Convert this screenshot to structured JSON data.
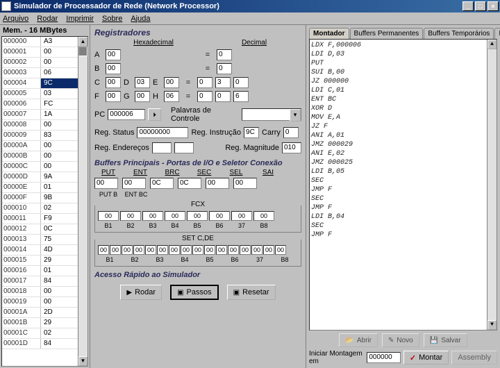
{
  "window": {
    "title": "Simulador de Processador de Rede (Network Processor)"
  },
  "menu": {
    "arquivo": "Arquivo",
    "rodar": "Rodar",
    "imprimir": "Imprimir",
    "sobre": "Sobre",
    "ajuda": "Ajuda"
  },
  "memory": {
    "title": "Mem. - 16 MBytes",
    "rows": [
      {
        "addr": "000000",
        "val": "A3"
      },
      {
        "addr": "000001",
        "val": "00"
      },
      {
        "addr": "000002",
        "val": "00"
      },
      {
        "addr": "000003",
        "val": "06"
      },
      {
        "addr": "000004",
        "val": "9C",
        "sel": true
      },
      {
        "addr": "000005",
        "val": "03"
      },
      {
        "addr": "000006",
        "val": "FC"
      },
      {
        "addr": "000007",
        "val": "1A"
      },
      {
        "addr": "000008",
        "val": "00"
      },
      {
        "addr": "000009",
        "val": "83"
      },
      {
        "addr": "00000A",
        "val": "00"
      },
      {
        "addr": "00000B",
        "val": "00"
      },
      {
        "addr": "00000C",
        "val": "00"
      },
      {
        "addr": "00000D",
        "val": "9A"
      },
      {
        "addr": "00000E",
        "val": "01"
      },
      {
        "addr": "00000F",
        "val": "9B"
      },
      {
        "addr": "000010",
        "val": "02"
      },
      {
        "addr": "000011",
        "val": "F9"
      },
      {
        "addr": "000012",
        "val": "0C"
      },
      {
        "addr": "000013",
        "val": "75"
      },
      {
        "addr": "000014",
        "val": "4D"
      },
      {
        "addr": "000015",
        "val": "29"
      },
      {
        "addr": "000016",
        "val": "01"
      },
      {
        "addr": "000017",
        "val": "84"
      },
      {
        "addr": "000018",
        "val": "00"
      },
      {
        "addr": "000019",
        "val": "00"
      },
      {
        "addr": "00001A",
        "val": "2D"
      },
      {
        "addr": "00001B",
        "val": "29"
      },
      {
        "addr": "00001C",
        "val": "02"
      },
      {
        "addr": "00001D",
        "val": "84"
      }
    ]
  },
  "registers": {
    "title": "Registradores",
    "hex_label": "Hexadecimal",
    "dec_label": "Decimal",
    "A": {
      "hex": "00",
      "dec": "0"
    },
    "B": {
      "hex": "00",
      "dec": "0"
    },
    "C": {
      "hex": "00",
      "dec": "0"
    },
    "D": {
      "hex": "03",
      "dec": "3"
    },
    "E": {
      "hex": "00",
      "dec": "0"
    },
    "F": {
      "hex": "00",
      "dec": "0"
    },
    "G": {
      "hex": "00",
      "dec": "0"
    },
    "H": {
      "hex": "06",
      "dec": "6"
    },
    "pc_label": "PC",
    "pc": "000006",
    "palavras_label": "Palavras de Controle",
    "status_label": "Reg. Status",
    "status": "00000000",
    "instrucao_label": "Reg. Instrução",
    "instrucao": "9C",
    "carry_label": "Carry",
    "carry": "0",
    "enderecos_label": "Reg. Endereços",
    "magnitude_label": "Reg. Magnitude",
    "magnitude": "010"
  },
  "buffers": {
    "title": "Buffers Principais - Portas de I/O e Seletor Conexão",
    "cols": [
      "PUT",
      "ENT",
      "BRC",
      "SEC",
      "SEL",
      "SAI"
    ],
    "vals": [
      "00",
      "00",
      "0C",
      "0C",
      "00",
      "00"
    ],
    "subs": [
      "PUT B",
      "ENT BC",
      "",
      "",
      "",
      ""
    ],
    "fcx_label": "FCX",
    "fcx_vals": [
      "00",
      "00",
      "00",
      "00",
      "00",
      "00",
      "00",
      "00"
    ],
    "fcx_hdr": [
      "B1",
      "B2",
      "B3",
      "B4",
      "B5",
      "B6",
      "37",
      "B8"
    ],
    "set_label": "SET C,DE",
    "set_vals": [
      "00",
      "00",
      "00",
      "00",
      "00",
      "00",
      "00",
      "00",
      "00",
      "00",
      "00",
      "00",
      "00",
      "00",
      "00",
      "00"
    ],
    "set_hdr": [
      "B1",
      "B2",
      "B3",
      "B4",
      "B5",
      "B6",
      "37",
      "B8"
    ]
  },
  "quick": {
    "title": "Acesso Rápido ao Simulador",
    "rodar": "Rodar",
    "passos": "Passos",
    "resetar": "Resetar"
  },
  "right": {
    "tabs": [
      "Montador",
      "Buffers Permanentes",
      "Buffers Temporários",
      "Paco"
    ],
    "asm": [
      "LDX F,000006",
      "LDI D,03",
      "PUT",
      "SUI B,00",
      "JZ 000000",
      "LDI C,01",
      "ENT BC",
      "XOR D",
      "MOV E,A",
      "JZ F",
      "ANI A,01",
      "JMZ 000029",
      "ANI E,02",
      "JMZ 000025",
      "LDI B,05",
      "SEC",
      "JMP F",
      "SEC",
      "JMP F",
      "LDI B,04",
      "SEC",
      "JMP F"
    ],
    "abrir": "Abrir",
    "novo": "Novo",
    "salvar": "Salvar",
    "mount_label": "Iniciar Montagem em",
    "mount_addr": "000000",
    "montar": "Montar",
    "assembly": "Assembly"
  }
}
